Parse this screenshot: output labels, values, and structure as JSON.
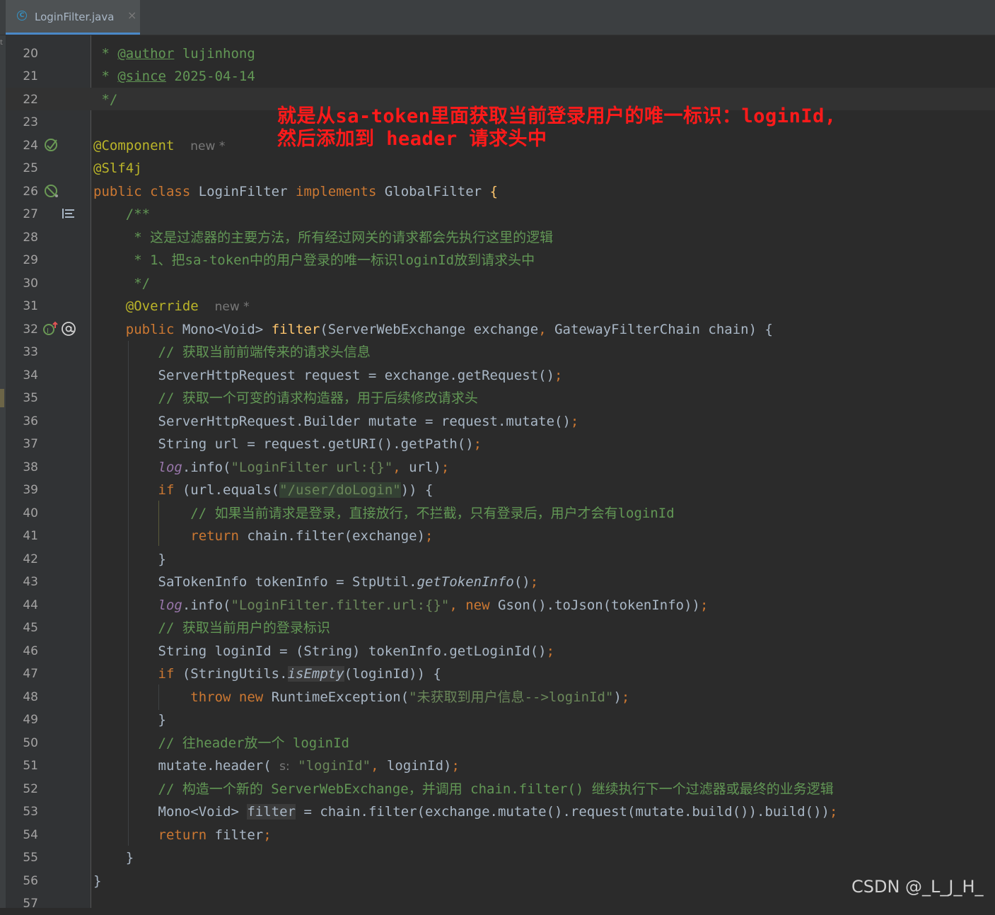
{
  "tab": {
    "file_name": "LoginFilter.java",
    "icon": "java-class-icon",
    "close": "×"
  },
  "line_numbers": [
    "20",
    "21",
    "22",
    "23",
    "24",
    "25",
    "26",
    "27",
    "28",
    "29",
    "30",
    "31",
    "32",
    "33",
    "34",
    "35",
    "36",
    "37",
    "38",
    "39",
    "40",
    "41",
    "42",
    "43",
    "44",
    "45",
    "46",
    "47",
    "48",
    "49",
    "50",
    "51",
    "52",
    "53",
    "54",
    "55",
    "56",
    "57"
  ],
  "code": {
    "l20": [
      "* ",
      "@author",
      " lujinhong"
    ],
    "l21": [
      "* ",
      "@since",
      " 2025-04-14"
    ],
    "l22": "*/",
    "l24": [
      "@Component",
      "new *"
    ],
    "l25": "@Slf4j",
    "l26": [
      "public class ",
      "LoginFilter ",
      "implements ",
      "GlobalFilter ",
      "{"
    ],
    "l27": "/**",
    "l28": "* 这是过滤器的主要方法，所有经过网关的请求都会先执行这里的逻辑",
    "l29": "* 1、把sa-token中的用户登录的唯一标识loginId放到请求头中",
    "l30": "*/",
    "l31": [
      "@Override",
      "new *"
    ],
    "l32": [
      "public ",
      "Mono<Void> ",
      "filter",
      "(ServerWebExchange exchange",
      ", ",
      "GatewayFilterChain chain) {"
    ],
    "l33": "// 获取当前前端传来的请求头信息",
    "l34": [
      "ServerHttpRequest request = exchange.getRequest()",
      ";"
    ],
    "l35": "// 获取一个可变的请求构造器，用于后续修改请求头",
    "l36": [
      "ServerHttpRequest.Builder mutate = request.mutate()",
      ";"
    ],
    "l37": [
      "String url = request.getURI().getPath()",
      ";"
    ],
    "l38": [
      "log",
      ".info(",
      "\"LoginFilter url:{}\"",
      ", ",
      "url)",
      ";"
    ],
    "l39": [
      "if ",
      "(url.equals(",
      "\"/user/doLogin\"",
      ")) {"
    ],
    "l40": "// 如果当前请求是登录，直接放行，不拦截，只有登录后，用户才会有loginId",
    "l41": [
      "return ",
      "chain.filter(exchange)",
      ";"
    ],
    "l42": "}",
    "l43": [
      "SaTokenInfo tokenInfo = StpUtil.",
      "getTokenInfo",
      "()",
      ";"
    ],
    "l44": [
      "log",
      ".info(",
      "\"LoginFilter.filter.url:{}\"",
      ", ",
      "new ",
      "Gson().toJson(tokenInfo))",
      ";"
    ],
    "l45": "// 获取当前用户的登录标识",
    "l46": [
      "String loginId = (String) tokenInfo.getLoginId()",
      ";"
    ],
    "l47": [
      "if ",
      "(StringUtils.",
      "isEmpty",
      "(loginId)) {"
    ],
    "l48": [
      "throw ",
      "new ",
      "RuntimeException(",
      "\"未获取到用户信息-->loginId\"",
      ")",
      ";"
    ],
    "l49": "}",
    "l50": "// 往header放一个 loginId",
    "l51": [
      "mutate.header( ",
      "s:",
      " \"loginId\"",
      ", ",
      "loginId)",
      ";"
    ],
    "l52": "// 构造一个新的 ServerWebExchange，并调用 chain.filter() 继续执行下一个过滤器或最终的业务逻辑",
    "l53": [
      "Mono<Void> ",
      "filter",
      " = chain.filter(exchange.mutate().request(mutate.build()).build())",
      ";"
    ],
    "l54": [
      "return ",
      "filter",
      ";"
    ],
    "l55": "}",
    "l56": "}"
  },
  "annotation": {
    "line1": "就是从sa-token里面获取当前登录用户的唯一标识：loginId,",
    "line2": "然后添加到 header 请求头中"
  },
  "watermark": "CSDN @_L_J_H_",
  "colors": {
    "background": "#2b2b2b",
    "keyword": "#cc7832",
    "string": "#6a8759",
    "comment": "#629755",
    "annotation": "#bbb529",
    "annotation_text": "#ff1a1a"
  }
}
